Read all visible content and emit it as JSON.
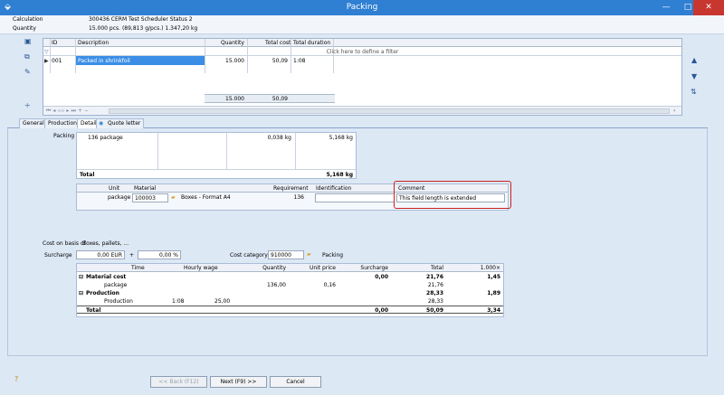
{
  "window": {
    "title": "Packing"
  },
  "info": {
    "calc_label": "Calculation",
    "calc_value": "300436 CERM Test Scheduler Status 2",
    "qty_label": "Quantity",
    "qty_value": "15.000 pcs. (89,813 g/pcs.) 1.347,20 kg"
  },
  "top_grid": {
    "columns": [
      "ID",
      "Description",
      "Quantity",
      "Total cost",
      "Total duration"
    ],
    "filter_text": "Click here to define a filter",
    "row": {
      "id": "001",
      "description": "Packed in shrinkfoil",
      "quantity": "15.000",
      "total_cost": "50,09",
      "duration": "1:08"
    },
    "footer_qty": "15.000",
    "footer_cost": "50,09"
  },
  "tabs": [
    "General",
    "Production",
    "Detail",
    "Quote letter"
  ],
  "packing": {
    "label": "Packing",
    "row": {
      "name": "136 package",
      "weight": "0,038 kg",
      "total": "5,168 kg"
    },
    "total_label": "Total",
    "total_value": "5,168 kg"
  },
  "material": {
    "columns": [
      "Unit",
      "Material",
      "Requirement",
      "Identification",
      "Comment"
    ],
    "row": {
      "unit": "package",
      "code": "100003",
      "name": "Boxes - Format A4",
      "req": "136",
      "ident": "",
      "comment": "This field length is extended"
    }
  },
  "cost_basis": {
    "label": "Cost on basis of",
    "value": "Boxes, pallets, ..."
  },
  "surcharge": {
    "label": "Surcharge",
    "amount": "0,00 EUR",
    "plus": "+",
    "percent": "0,00 %"
  },
  "cost_category": {
    "label": "Cost category",
    "code": "910000",
    "name": "Packing"
  },
  "cost_table": {
    "columns": [
      "Time",
      "Hourly wage",
      "Quantity",
      "Unit price",
      "Surcharge",
      "Total",
      "1.000×"
    ],
    "rows": [
      {
        "label": "Material cost",
        "time": "",
        "wage": "",
        "qty": "",
        "price": "",
        "sur": "0,00",
        "total": "21,76",
        "k": "1,45"
      },
      {
        "label": "package",
        "time": "",
        "wage": "",
        "qty": "136,00",
        "price": "0,16",
        "sur": "",
        "total": "21,76",
        "k": ""
      },
      {
        "label": "Production",
        "time": "",
        "wage": "",
        "qty": "",
        "price": "",
        "sur": "",
        "total": "28,33",
        "k": "1,89"
      },
      {
        "label": "Production",
        "time": "1:08",
        "wage": "25,00",
        "qty": "",
        "price": "",
        "sur": "",
        "total": "28,33",
        "k": ""
      },
      {
        "label": "Total",
        "time": "",
        "wage": "",
        "qty": "",
        "price": "",
        "sur": "0,00",
        "total": "50,09",
        "k": "3,34"
      }
    ]
  },
  "buttons": {
    "back": "<< Back (F12)",
    "next": "Next (F9) >>",
    "cancel": "Cancel"
  },
  "accent": "#2f7fd3",
  "highlight": "#cc2020"
}
